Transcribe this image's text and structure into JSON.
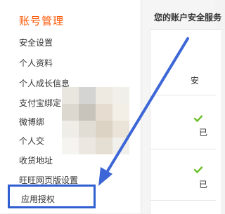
{
  "sidebar": {
    "section_title": "账号管理",
    "items": [
      {
        "label": "安全设置"
      },
      {
        "label": "个人资料"
      },
      {
        "label": "个人成长信息"
      },
      {
        "label": "支付宝绑定"
      },
      {
        "label": "微博绑"
      },
      {
        "label": "个人交"
      },
      {
        "label": "收货地址"
      },
      {
        "label": "旺旺网页版设置"
      },
      {
        "label": "应用授权",
        "highlighted": true
      }
    ]
  },
  "main": {
    "panel_title": "您的账户安全服务",
    "rows": [
      {
        "label": "安"
      },
      {
        "status": "已"
      },
      {
        "status": "已"
      }
    ]
  },
  "colors": {
    "accent": "#ff5500",
    "highlight_border": "#2f5fd0",
    "check_green": "#6cbf2a"
  }
}
